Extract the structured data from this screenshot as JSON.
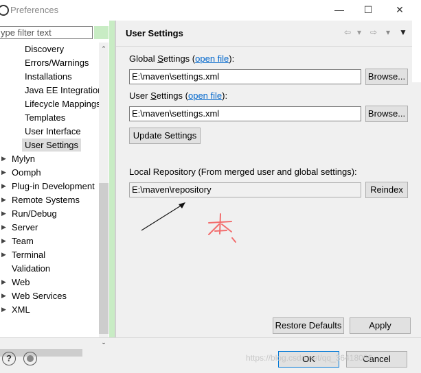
{
  "window": {
    "title": "Preferences"
  },
  "filter": {
    "placeholder": "ype filter text"
  },
  "tree": {
    "items": [
      {
        "label": "Discovery",
        "expandable": false
      },
      {
        "label": "Errors/Warnings",
        "expandable": false
      },
      {
        "label": "Installations",
        "expandable": false
      },
      {
        "label": "Java EE Integration",
        "expandable": false
      },
      {
        "label": "Lifecycle Mappings",
        "expandable": false
      },
      {
        "label": "Templates",
        "expandable": false
      },
      {
        "label": "User Interface",
        "expandable": false
      },
      {
        "label": "User Settings",
        "expandable": false,
        "selected": true
      },
      {
        "label": "Mylyn",
        "expandable": true
      },
      {
        "label": "Oomph",
        "expandable": true
      },
      {
        "label": "Plug-in Development",
        "expandable": true
      },
      {
        "label": "Remote Systems",
        "expandable": true
      },
      {
        "label": "Run/Debug",
        "expandable": true
      },
      {
        "label": "Server",
        "expandable": true
      },
      {
        "label": "Team",
        "expandable": true
      },
      {
        "label": "Terminal",
        "expandable": true
      },
      {
        "label": "Validation",
        "expandable": false
      },
      {
        "label": "Web",
        "expandable": true
      },
      {
        "label": "Web Services",
        "expandable": true
      },
      {
        "label": "XML",
        "expandable": true
      }
    ]
  },
  "page": {
    "title": "User Settings",
    "global_prefix": "Global ",
    "global_mnemonic": "S",
    "global_suffix": "ettings (",
    "global_link": "open file",
    "global_close": "):",
    "global_path": "E:\\maven\\settings.xml",
    "user_prefix": "User ",
    "user_mnemonic": "S",
    "user_suffix": "ettings (",
    "user_link": "open file",
    "user_close": "):",
    "user_path": "E:\\maven\\settings.xml",
    "browse_label": "Browse...",
    "update_label": "Update Settings",
    "local_repo_label": "Local Repository (From merged user and global settings):",
    "local_repo_path": "E:\\maven\\repository",
    "reindex_label": "Reindex",
    "restore_label": "Restore Defaults",
    "apply_label": "Apply"
  },
  "footer": {
    "ok_label": "OK",
    "cancel_label": "Cancel",
    "watermark": "https://blog.csdn.net/qq_36418066"
  },
  "annotation": {
    "handwritten_text": "本"
  },
  "colors": {
    "accent_green": "#c8ecc4",
    "link": "#0066cc",
    "annotation": "#f26d6d"
  }
}
